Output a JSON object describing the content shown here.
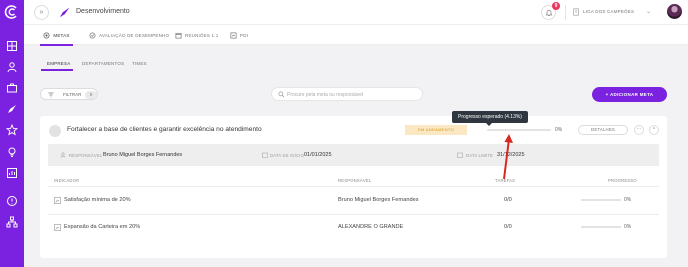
{
  "header": {
    "page_title": "Desenvolvimento",
    "notification_count": "9",
    "org_name": "LIGA DOS CAMPEÕES"
  },
  "module_tabs": [
    {
      "label": "METAS",
      "active": true
    },
    {
      "label": "AVALIAÇÃO DE DESEMPENHO",
      "active": false
    },
    {
      "label": "REUNIÕES 1:1",
      "active": false
    },
    {
      "label": "PDI",
      "active": false
    }
  ],
  "sub_tabs": [
    {
      "label": "EMPRESA",
      "active": true
    },
    {
      "label": "DEPARTAMENTOS",
      "active": false
    },
    {
      "label": "TIMES",
      "active": false
    }
  ],
  "toolbar": {
    "filter_label": "FILTRAR",
    "filter_count": "0",
    "search_placeholder": "Procure pela meta ou responsável",
    "add_button_label": "ADICIONAR META"
  },
  "goal": {
    "title": "Fortalecer a base de clientes e garantir excelência no atendimento",
    "status": "EM ANDAMENTO",
    "progress_percent": 0,
    "progress_expected_percent": 4.13,
    "progress_label": "0%",
    "details_label": "DETALHES",
    "more_label": "···",
    "collapse_label": "^",
    "tooltip": "Progresso esperado (4.13%)",
    "responsible_label": "RESPONSÁVEL",
    "responsible_value": "Bruno Miguel Borges Fernandes",
    "start_label": "DATA DE INÍCIO",
    "start_value": "01/01/2025",
    "end_label": "DATA LIMITE",
    "end_value": "31/12/2025"
  },
  "table": {
    "headers": {
      "indicator": "INDICADOR",
      "responsible": "RESPONSÁVEL",
      "tasks": "TAREFAS",
      "progress": "PROGRESSO"
    },
    "rows": [
      {
        "name": "Satisfação mínima de 20%",
        "responsible": "Bruno Miguel Borges Fernandes",
        "tasks": "0/0",
        "progress_label": "0%",
        "progress_percent": 0
      },
      {
        "name": "Expansão da Carteira em 20%",
        "responsible": "ALEXANDRE O GRANDE",
        "tasks": "0/0",
        "progress_label": "0%",
        "progress_percent": 0
      }
    ]
  },
  "icons": {
    "logo": "logo-icon",
    "collapse": "double-chevron-right-icon",
    "page": "rocket-icon",
    "bell": "bell-icon",
    "org": "building-icon",
    "search": "search-icon",
    "filter": "filter-icon"
  },
  "colors": {
    "brand": "#7b22e0",
    "badge": "#e8365d",
    "status_bg": "#fbe8c2",
    "status_text": "#d59a1d",
    "annotation_arrow": "#d62a20"
  }
}
